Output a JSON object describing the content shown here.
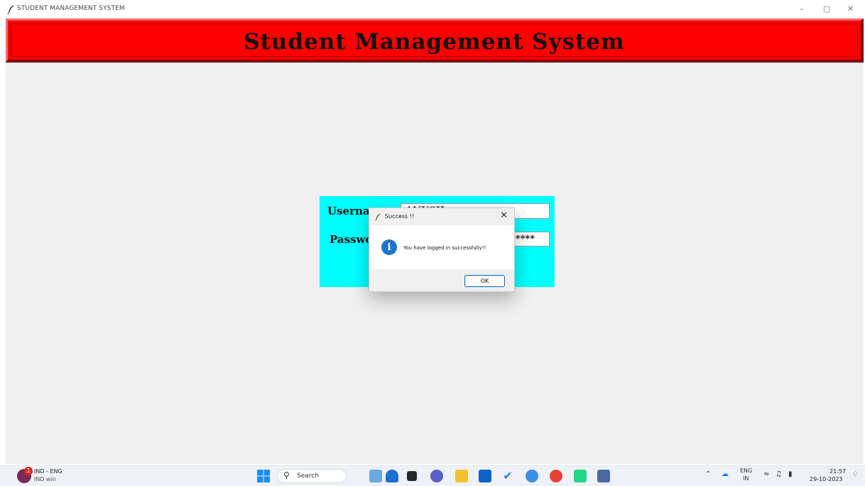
{
  "window": {
    "title": "STUDENT MANAGEMENT SYSTEM",
    "controls": {
      "minimize": "–",
      "maximize": "▢",
      "close": "✕"
    }
  },
  "header": {
    "title": "Student Management System"
  },
  "login": {
    "username_label": "Username",
    "username_value": "ANUSH",
    "password_label": "Password",
    "password_value": "****"
  },
  "dialog": {
    "title": "Success !!",
    "message": "You have logged in successfully!!",
    "ok_label": "OK",
    "close_glyph": "✕",
    "icon_glyph": "i"
  },
  "taskbar": {
    "lang_line1": "IND - ENG",
    "lang_line2": "IND win",
    "weather_badge": "1",
    "search_label": "Search",
    "tray_lang_top": "ENG",
    "tray_lang_bottom": "IN",
    "time": "21:57",
    "date": "29-10-2023"
  },
  "colors": {
    "header_bg": "#ff0000",
    "login_bg": "#00ffff",
    "app_bg": "#f0f0f0",
    "info_icon": "#1e73cf"
  },
  "icons": [
    "feather-icon",
    "info-icon",
    "windows-start-icon",
    "search-icon",
    "wifi-icon",
    "volume-icon",
    "battery-icon",
    "bell-icon",
    "onedrive-icon",
    "chevron-up-icon"
  ]
}
